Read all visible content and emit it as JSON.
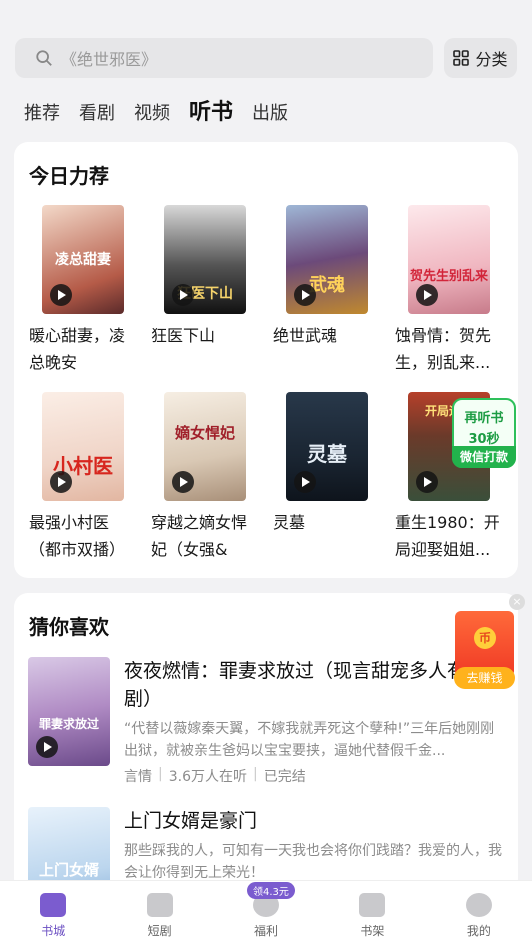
{
  "search": {
    "placeholder": "《绝世邪医》",
    "category_label": "分类"
  },
  "tabs": [
    {
      "label": "推荐"
    },
    {
      "label": "看剧"
    },
    {
      "label": "视频"
    },
    {
      "label": "听书"
    },
    {
      "label": "出版"
    }
  ],
  "today": {
    "title": "今日力荐",
    "items": [
      {
        "title": "暖心甜妻，凌总晚安",
        "cover_text": "凌总甜妻"
      },
      {
        "title": "狂医下山",
        "cover_text": "狂医下山"
      },
      {
        "title": "绝世武魂",
        "cover_text": "武魂"
      },
      {
        "title": "蚀骨情：贺先生，别乱来...",
        "cover_text": "贺先生别乱来"
      },
      {
        "title": "最强小村医（都市双播）",
        "cover_text": "小村医"
      },
      {
        "title": "穿越之嫡女悍妃（女强&宫...",
        "cover_text": "嫡女悍妃"
      },
      {
        "title": "灵墓",
        "cover_text": "灵墓"
      },
      {
        "title": "重生1980：开局迎娶姐姐...",
        "cover_text": "开局迎娶"
      }
    ]
  },
  "listen_badge": {
    "line1": "再听书",
    "line2": "30秒",
    "line3": "微信打款"
  },
  "guess": {
    "title": "猜你喜欢",
    "items": [
      {
        "title": "夜夜燃情：罪妻求放过（现言甜宠多人有声剧）",
        "desc": "“代替以薇嫁秦天翼，不嫁我就弄死这个孽种!”三年后她刚刚出狱，就被亲生爸妈以宝宝要挟，逼她代替假千金...",
        "genre": "言情",
        "listeners": "3.6万人在听",
        "status": "已完结",
        "cover_text": "罪妻求放过"
      },
      {
        "title": "上门女婿是豪门",
        "desc": "那些踩我的人，可知有一天我也会将你们践踏？我爱的人，我会让你得到无上荣光！",
        "cover_text": "上门女婿"
      }
    ]
  },
  "red_packet": {
    "coin": "币",
    "button": "去赚钱",
    "close": "×"
  },
  "bottom_nav": [
    {
      "label": "书城",
      "active": true
    },
    {
      "label": "短剧"
    },
    {
      "label": "福利",
      "pill": "领4.3元"
    },
    {
      "label": "书架"
    },
    {
      "label": "我的"
    }
  ]
}
